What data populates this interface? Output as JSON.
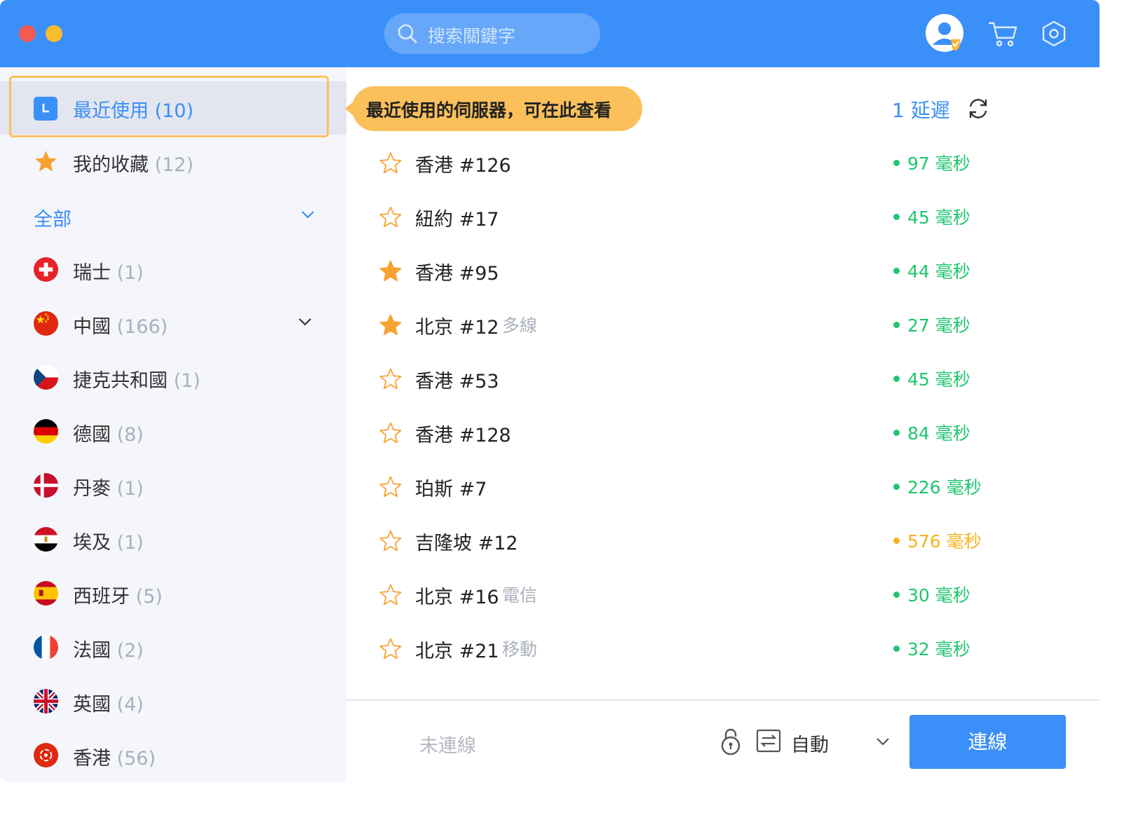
{
  "header": {
    "search_placeholder": "搜索關鍵字"
  },
  "sidebar": {
    "recent": {
      "label": "最近使用",
      "count": "(10)"
    },
    "favorites": {
      "label": "我的收藏",
      "count": "(12)"
    },
    "all": {
      "label": "全部"
    },
    "countries": [
      {
        "label": "瑞士",
        "count": "(1)"
      },
      {
        "label": "中國",
        "count": "(166)"
      },
      {
        "label": "捷克共和國",
        "count": "(1)"
      },
      {
        "label": "德國",
        "count": "(8)"
      },
      {
        "label": "丹麥",
        "count": "(1)"
      },
      {
        "label": "埃及",
        "count": "(1)"
      },
      {
        "label": "西班牙",
        "count": "(5)"
      },
      {
        "label": "法國",
        "count": "(2)"
      },
      {
        "label": "英國",
        "count": "(4)"
      },
      {
        "label": "香港",
        "count": "(56)"
      }
    ]
  },
  "tooltip": {
    "text": "最近使用的伺服器，可在此查看"
  },
  "list_header": {
    "sort_label": "1 延遲"
  },
  "servers": [
    {
      "name": "香港 #126",
      "tag": "",
      "latency": "97 毫秒",
      "favorite": false,
      "status": "good"
    },
    {
      "name": "紐約 #17",
      "tag": "",
      "latency": "45 毫秒",
      "favorite": false,
      "status": "good"
    },
    {
      "name": "香港 #95",
      "tag": "",
      "latency": "44 毫秒",
      "favorite": true,
      "status": "good"
    },
    {
      "name": "北京 #12",
      "tag": "多線",
      "latency": "27 毫秒",
      "favorite": true,
      "status": "good"
    },
    {
      "name": "香港 #53",
      "tag": "",
      "latency": "45 毫秒",
      "favorite": false,
      "status": "good"
    },
    {
      "name": "香港 #128",
      "tag": "",
      "latency": "84 毫秒",
      "favorite": false,
      "status": "good"
    },
    {
      "name": "珀斯 #7",
      "tag": "",
      "latency": "226 毫秒",
      "favorite": false,
      "status": "good"
    },
    {
      "name": "吉隆坡 #12",
      "tag": "",
      "latency": "576 毫秒",
      "favorite": false,
      "status": "warn"
    },
    {
      "name": "北京 #16",
      "tag": "電信",
      "latency": "30 毫秒",
      "favorite": false,
      "status": "good"
    },
    {
      "name": "北京 #21",
      "tag": "移動",
      "latency": "32 毫秒",
      "favorite": false,
      "status": "good"
    }
  ],
  "colors": {
    "accent": "#3b8ff8",
    "good": "#1fc66f",
    "warn": "#f6b31c",
    "star": "#f7a233"
  },
  "footer": {
    "status": "未連線",
    "mode": "自動",
    "connect_label": "連線"
  }
}
